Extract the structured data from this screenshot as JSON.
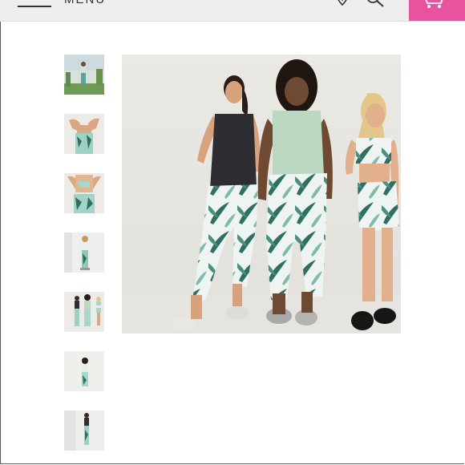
{
  "header": {
    "menu_label": "MENU",
    "menu_icon": "hamburger-icon",
    "wishlist_icon": "heart-icon",
    "search_icon": "search-icon",
    "cart_icon": "cart-icon",
    "cart_color": "#e8539f"
  },
  "gallery": {
    "thumbnail_count": 7,
    "selected_thumbnail": 5,
    "main_image": "three-women-in-tropical-print-activewear-photo"
  },
  "colors": {
    "header_bg": "#eeeeee",
    "accent": "#e8539f"
  }
}
